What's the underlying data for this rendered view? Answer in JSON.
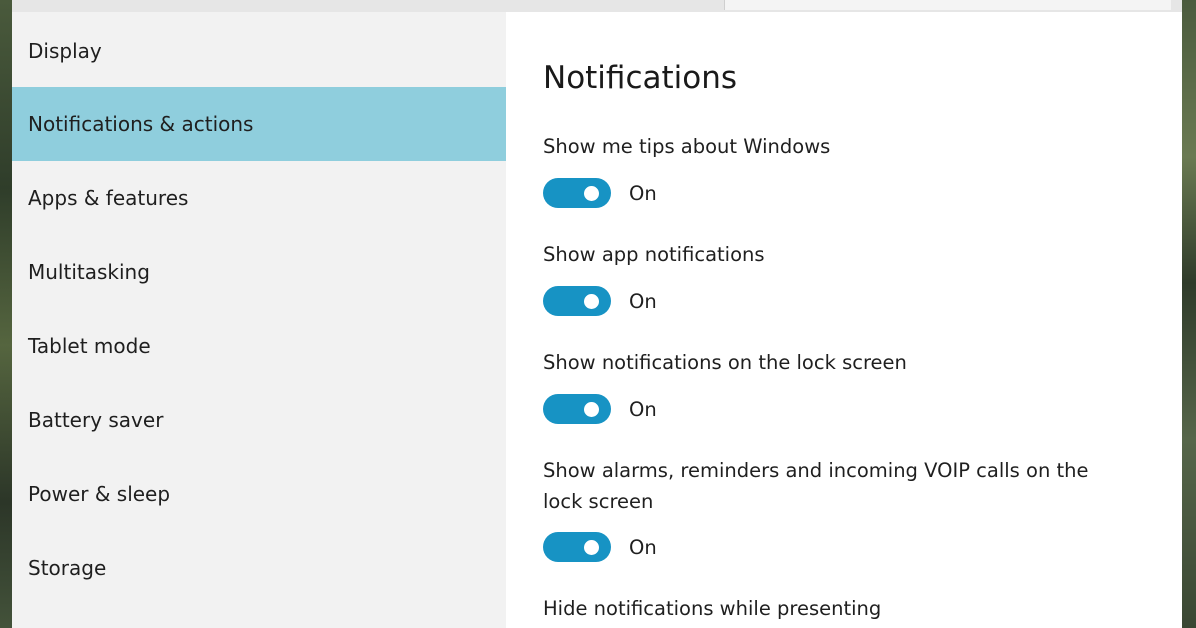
{
  "sidebar": {
    "items": [
      {
        "label": "Display",
        "selected": false
      },
      {
        "label": "Notifications & actions",
        "selected": true
      },
      {
        "label": "Apps & features",
        "selected": false
      },
      {
        "label": "Multitasking",
        "selected": false
      },
      {
        "label": "Tablet mode",
        "selected": false
      },
      {
        "label": "Battery saver",
        "selected": false
      },
      {
        "label": "Power & sleep",
        "selected": false
      },
      {
        "label": "Storage",
        "selected": false
      }
    ]
  },
  "main": {
    "title": "Notifications",
    "settings": [
      {
        "label": "Show me tips about Windows",
        "state": "On",
        "on": true
      },
      {
        "label": "Show app notifications",
        "state": "On",
        "on": true
      },
      {
        "label": "Show notifications on the lock screen",
        "state": "On",
        "on": true
      },
      {
        "label": "Show alarms, reminders and incoming VOIP calls on the lock screen",
        "state": "On",
        "on": true
      },
      {
        "label": "Hide notifications while presenting"
      }
    ]
  },
  "colors": {
    "accent": "#1793c4",
    "selected_nav": "#8fcedd",
    "sidebar_bg": "#f2f2f2",
    "content_bg": "#ffffff"
  }
}
